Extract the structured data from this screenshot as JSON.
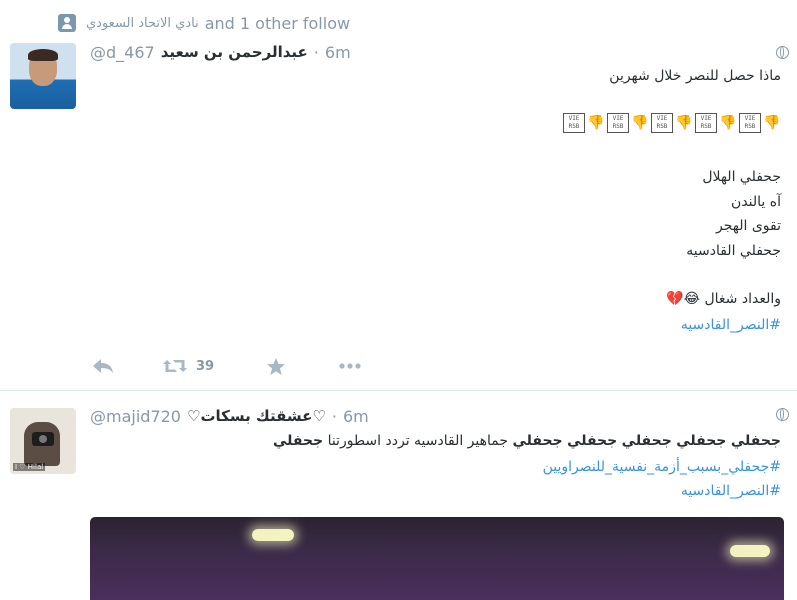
{
  "tweet1": {
    "follow_context": {
      "arabic": "نادي الاتحاد السعودي",
      "text": "and 1 other follow"
    },
    "author": {
      "name": "عبدالرحمن بن سعيد",
      "handle": "@d_467",
      "time": "6m"
    },
    "body": {
      "line1": "ماذا حصل للنصر خلال شهرين",
      "poem": [
        "جحفلي الهلال",
        "آه يالندن",
        "تقوى الهجر",
        "جحفلي القادسيه"
      ],
      "closing": "والعداد شغال",
      "closing_emoji": "😂💔",
      "hashtag": "#النصر_القادسيه"
    },
    "emoji_row": [
      "👎",
      "🆚",
      "👎",
      "🆚",
      "👎",
      "🆚",
      "👎",
      "🆚",
      "👎",
      "🆚"
    ],
    "actions": {
      "retweet_count": "39"
    }
  },
  "tweet2": {
    "author": {
      "name": "♡عشقتك بسكات♡",
      "handle": "@majid720",
      "time": "6m"
    },
    "avatar_tag": "I ♡ Hilal",
    "body": {
      "word": "جحفلي",
      "middle": "جماهير القادسيه تردد اسطورتنا",
      "hashtag1": "#جحفلي_بسبب_أزمة_نفسية_للنصراويين",
      "hashtag2": "#النصر_القادسيه"
    }
  },
  "colors": {
    "link": "#3b94d9",
    "muted": "#8899a6",
    "text": "#292f33",
    "divider": "#e1e8ed"
  }
}
